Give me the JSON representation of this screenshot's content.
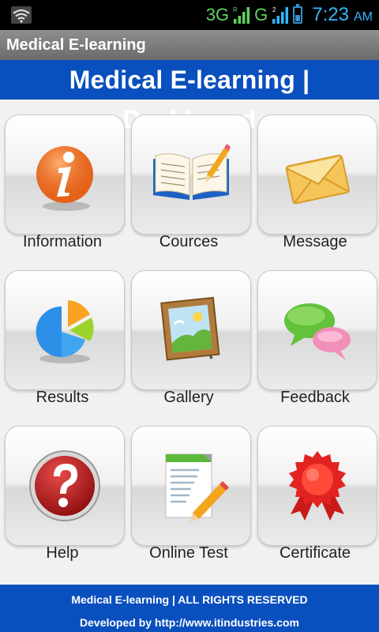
{
  "status_bar": {
    "network_labels": [
      "3G",
      "G"
    ],
    "roaming_marker": "R",
    "sim2_marker": "2",
    "time": "7:23",
    "ampm": "AM"
  },
  "app_title": "Medical E-learning",
  "dashboard_title": "Medical E-learning | Dashboard",
  "tiles": [
    {
      "label": "Information",
      "icon": "info-icon"
    },
    {
      "label": "Cources",
      "icon": "book-pencil-icon"
    },
    {
      "label": "Message",
      "icon": "envelope-icon"
    },
    {
      "label": "Results",
      "icon": "pie-chart-icon"
    },
    {
      "label": "Gallery",
      "icon": "picture-frame-icon"
    },
    {
      "label": "Feedback",
      "icon": "speech-bubbles-icon"
    },
    {
      "label": "Help",
      "icon": "question-icon"
    },
    {
      "label": "Online Test",
      "icon": "document-pencil-icon"
    },
    {
      "label": "Certificate",
      "icon": "award-ribbon-icon"
    }
  ],
  "footer": {
    "line1": "Medical E-learning | ALL RIGHTS RESERVED",
    "line2": "Developed by http://www.itindustries.com"
  },
  "colors": {
    "brand_blue": "#0a4fbe",
    "status_green": "#5fd25f",
    "status_blue": "#35b6ff"
  }
}
